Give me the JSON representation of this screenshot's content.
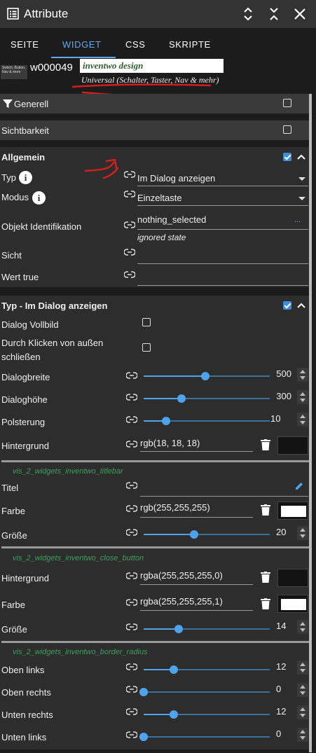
{
  "header": {
    "title": "Attribute",
    "icons": [
      "list-icon",
      "expand-icon",
      "collapse-icon",
      "close-icon"
    ]
  },
  "tabs": [
    "SEITE",
    "WIDGET",
    "CSS",
    "SKRIPTE"
  ],
  "active_tab": "WIDGET",
  "widget": {
    "thumb_text": "Switch, Button, Nav & more",
    "id": "w000049",
    "set_name": "inventwo design",
    "set_description": "Universal (Schalter, Taster, Nav & mehr)"
  },
  "sections": {
    "generell": {
      "label": "Generell",
      "checked": false
    },
    "sichtbarkeit": {
      "label": "Sichtbarkeit",
      "checked": false
    },
    "allgemein": {
      "label": "Allgemein",
      "checked": true,
      "typ_label": "Typ",
      "typ_value": "Im Dialog anzeigen",
      "modus_label": "Modus",
      "modus_value": "Einzeltaste",
      "oid_label": "Objekt Identifikation",
      "oid_value": "nothing_selected",
      "oid_more": "...",
      "oid_state": "ignored state",
      "sicht_label": "Sicht",
      "wert_true_label": "Wert true"
    },
    "typ_dialog": {
      "label": "Typ - Im Dialog anzeigen",
      "checked": true,
      "vollbild_label": "Dialog Vollbild",
      "vollbild_checked": false,
      "close_outside_label_1": "Durch Klicken von außen",
      "close_outside_label_2": "schließen",
      "close_outside_checked": false,
      "breite_label": "Dialogbreite",
      "breite_value": "500",
      "breite_fraction": 0.49,
      "hoehe_label": "Dialoghöhe",
      "hoehe_value": "300",
      "hoehe_fraction": 0.3,
      "polsterung_label": "Polsterung",
      "polsterung_value": "10",
      "polsterung_fraction": 0.18,
      "hintergrund_label": "Hintergrund",
      "hintergrund_value": "rgb(18, 18, 18)",
      "hintergrund_color": "#121212",
      "titlebar_group": "vis_2_widgets_inventwo_titlebar",
      "titel_label": "Titel",
      "titel_value": "",
      "tb_farbe_label": "Farbe",
      "tb_farbe_value": "rgb(255,255,255)",
      "tb_farbe_color": "#ffffff",
      "tb_groesse_label": "Größe",
      "tb_groesse_value": "20",
      "tb_groesse_fraction": 0.4,
      "close_group": "vis_2_widgets_inventwo_close_button",
      "cb_hintergrund_label": "Hintergrund",
      "cb_hintergrund_value": "rgba(255,255,255,0)",
      "cb_hintergrund_color": "#121212",
      "cb_farbe_label": "Farbe",
      "cb_farbe_value": "rgba(255,255,255,1)",
      "cb_farbe_color": "#ffffff",
      "cb_groesse_label": "Größe",
      "cb_groesse_value": "14",
      "cb_groesse_fraction": 0.28,
      "radius_group": "vis_2_widgets_inventwo_border_radius",
      "oben_links_label": "Oben links",
      "oben_links_value": "12",
      "oben_links_fraction": 0.24,
      "oben_rechts_label": "Oben rechts",
      "oben_rechts_value": "0",
      "oben_rechts_fraction": 0.0,
      "unten_rechts_label": "Unten rechts",
      "unten_rechts_value": "12",
      "unten_rechts_fraction": 0.24,
      "unten_links_label": "Unten links",
      "unten_links_value": "0",
      "unten_links_fraction": 0.0
    }
  },
  "colors": {
    "accent": "#63a8ef",
    "slider": "#4fa3ea",
    "group_label": "#3aa05a",
    "annotation": "#d21e1e"
  }
}
